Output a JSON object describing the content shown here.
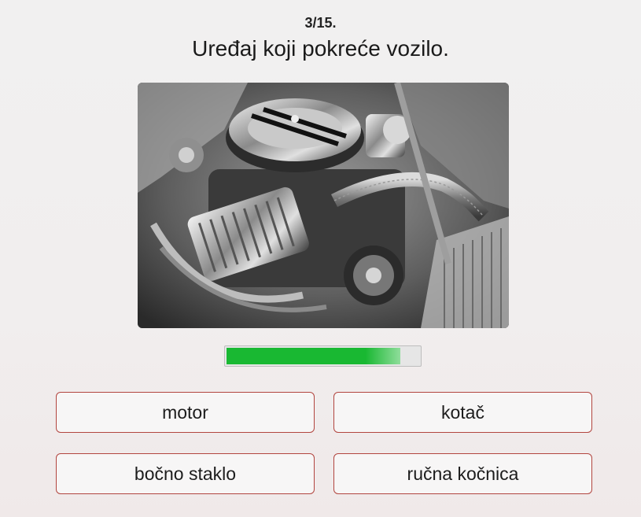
{
  "quiz": {
    "counter": "3/15.",
    "question": "Uređaj koji pokreće vozilo.",
    "image_subject": "car-engine-photo",
    "progress": 0.9,
    "progress_color": "#19b832",
    "answers": [
      {
        "label": "motor"
      },
      {
        "label": "kotač"
      },
      {
        "label": "bočno staklo"
      },
      {
        "label": "ručna kočnica"
      }
    ]
  }
}
